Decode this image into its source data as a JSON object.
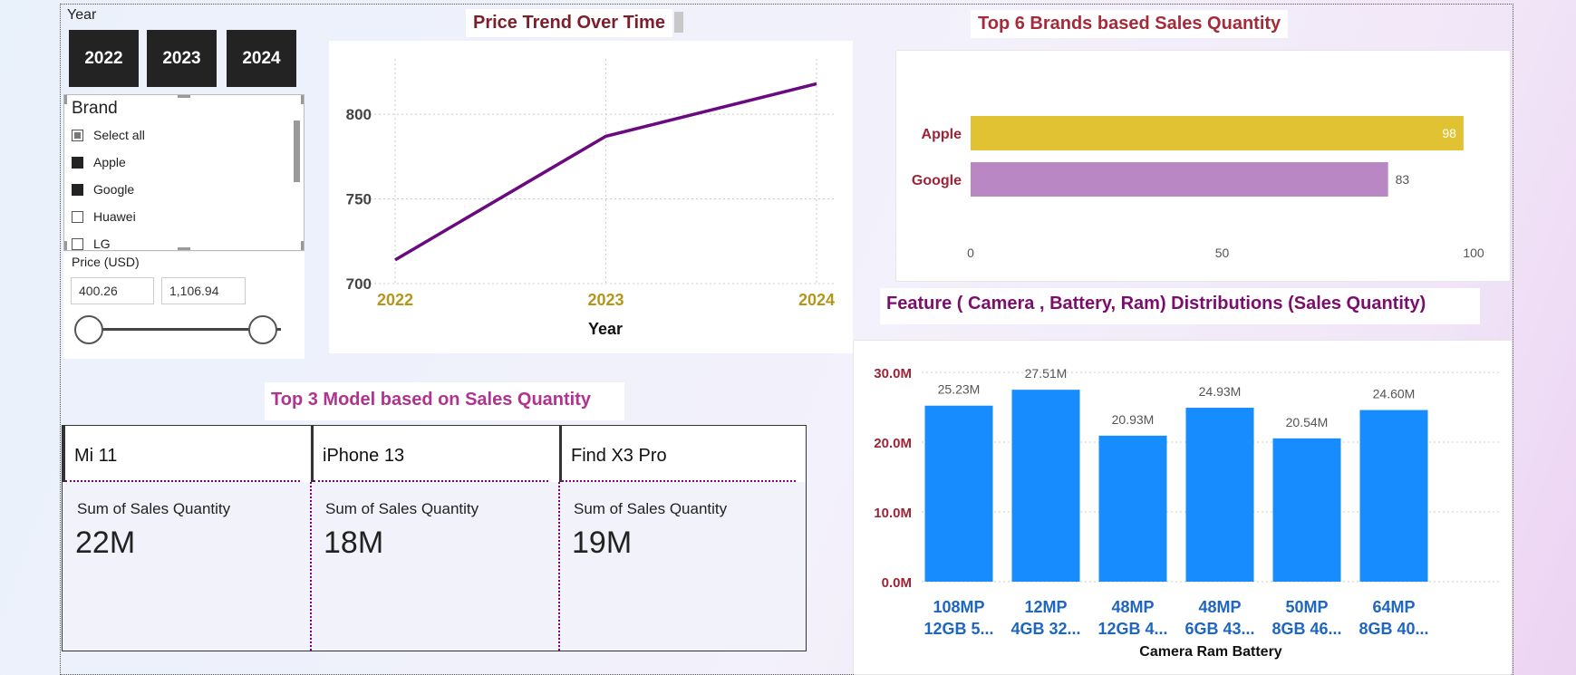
{
  "year_slicer": {
    "label": "Year",
    "options": [
      "2022",
      "2023",
      "2024"
    ]
  },
  "brand_slicer": {
    "title": "Brand",
    "items": [
      {
        "label": "Select all",
        "state": "partial"
      },
      {
        "label": "Apple",
        "state": "checked"
      },
      {
        "label": "Google",
        "state": "checked"
      },
      {
        "label": "Huawei",
        "state": "unchecked"
      },
      {
        "label": "LG",
        "state": "unchecked"
      }
    ]
  },
  "price_slicer": {
    "label": "Price (USD)",
    "min_value": "400.26",
    "max_value": "1,106.94"
  },
  "line_chart": {
    "title": "Price Trend Over Time",
    "chart_data": {
      "type": "line",
      "x": [
        "2022",
        "2023",
        "2024"
      ],
      "y": [
        714,
        787,
        818
      ],
      "xlabel": "Year",
      "ylabel": "",
      "ylim": [
        700,
        830
      ],
      "yticks": [
        "700",
        "750",
        "800"
      ],
      "color": "#6b0a7e",
      "grid": true
    }
  },
  "bar_chart": {
    "title": "Top 6 Brands based Sales Quantity",
    "chart_data": {
      "type": "bar",
      "orientation": "horizontal",
      "categories": [
        "Apple",
        "Google"
      ],
      "values": [
        98,
        83
      ],
      "value_labels": [
        "98",
        "83"
      ],
      "colors": [
        "#e1c233",
        "#b987c4"
      ],
      "xlim": [
        0,
        100
      ],
      "xticks": [
        "0",
        "50",
        "100"
      ]
    }
  },
  "column_chart": {
    "title": "Feature ( Camera , Battery, Ram) Distributions (Sales Quantity)",
    "chart_data": {
      "type": "bar",
      "categories": [
        [
          "108MP",
          "12GB 5..."
        ],
        [
          "12MP",
          "4GB 32..."
        ],
        [
          "48MP",
          "12GB 4..."
        ],
        [
          "48MP",
          "6GB 43..."
        ],
        [
          "50MP",
          "8GB 46..."
        ],
        [
          "64MP",
          "8GB 40..."
        ]
      ],
      "values": [
        25.23,
        27.51,
        20.93,
        24.93,
        20.54,
        24.6
      ],
      "value_labels": [
        "25.23M",
        "27.51M",
        "20.93M",
        "24.93M",
        "20.54M",
        "24.60M"
      ],
      "xlabel": "Camera Ram Battery",
      "ylim": [
        0,
        30
      ],
      "yticks": [
        "0.0M",
        "10.0M",
        "20.0M",
        "30.0M"
      ],
      "color": "#168cff",
      "grid": true
    }
  },
  "top_models": {
    "title": "Top 3 Model based on Sales Quantity",
    "cards": [
      {
        "name": "Mi 11",
        "metric_label": "Sum of Sales Quantity",
        "value": "22M"
      },
      {
        "name": "iPhone 13",
        "metric_label": "Sum of Sales Quantity",
        "value": "18M"
      },
      {
        "name": "Find X3 Pro",
        "metric_label": "Sum of Sales Quantity",
        "value": "19M"
      }
    ]
  },
  "colors": {
    "title_dark_red": "#7b1e2b",
    "title_red": "#a52a3a",
    "title_purple": "#7a0d6e",
    "title_pink": "#b0338f",
    "axis_gold": "#b5961c",
    "axis_red": "#9c2436",
    "axis_blue": "#1f66c1"
  }
}
